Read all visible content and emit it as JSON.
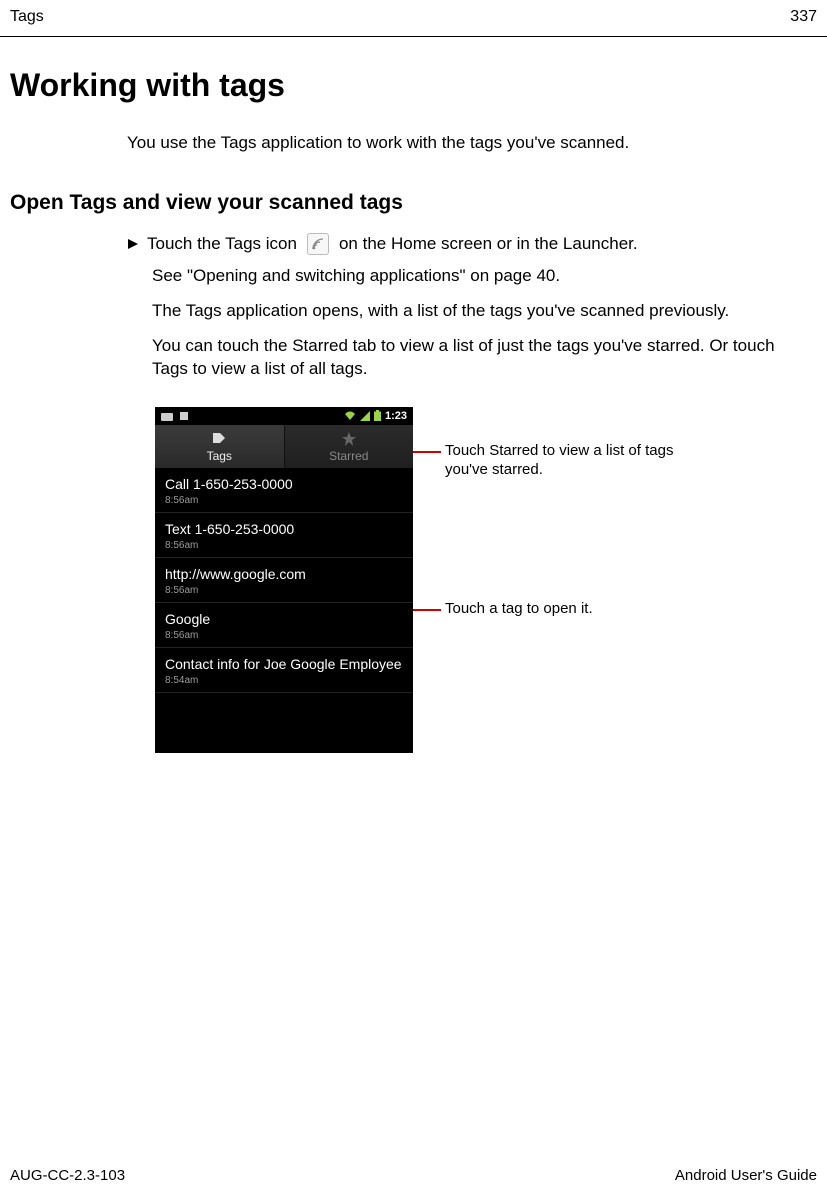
{
  "header": {
    "section": "Tags",
    "page_number": "337"
  },
  "title": "Working with tags",
  "intro": "You use the Tags application to work with the tags you've scanned.",
  "section_heading": "Open Tags and view your scanned tags",
  "bullet": {
    "before_icon": "Touch the Tags icon",
    "after_icon": "on the Home screen or in the Launcher."
  },
  "paragraphs": {
    "p1": "See \"Opening and switching applications\" on page 40.",
    "p2": "The Tags application opens, with a list of the tags you've scanned previously.",
    "p3": "You can touch the Starred tab to view a list of just the tags you've starred. Or touch Tags to view a list of all tags."
  },
  "device": {
    "status_time": "1:23",
    "tabs": {
      "active": "Tags",
      "inactive": "Starred"
    },
    "items": [
      {
        "title": "Call 1-650-253-0000",
        "time": "8:56am"
      },
      {
        "title": "Text 1-650-253-0000",
        "time": "8:56am"
      },
      {
        "title": "http://www.google.com",
        "time": "8:56am"
      },
      {
        "title": "Google",
        "time": "8:56am"
      },
      {
        "title": "Contact info for Joe Google Employee",
        "time": "8:54am"
      }
    ]
  },
  "callouts": {
    "c1": "Touch Starred to view a list of tags you've starred.",
    "c2": "Touch a tag to open it."
  },
  "footer": {
    "left": "AUG-CC-2.3-103",
    "right": "Android User's Guide"
  }
}
